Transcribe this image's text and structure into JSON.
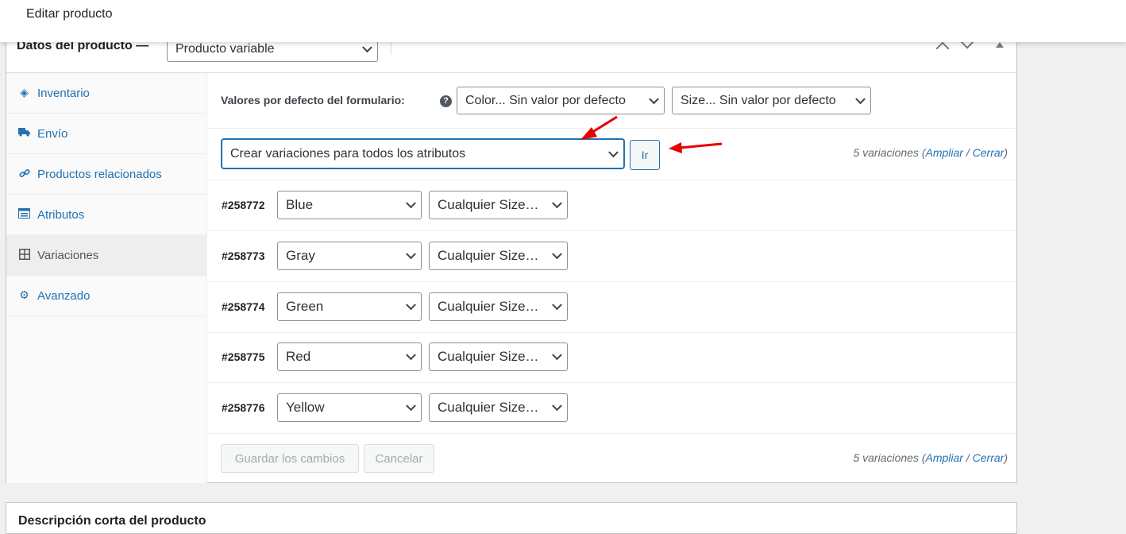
{
  "page": {
    "title": "Editar producto"
  },
  "product_data": {
    "header_label": "Datos del producto —",
    "product_type": "Producto variable"
  },
  "tabs": [
    {
      "label": "Inventario",
      "icon": "tag-icon"
    },
    {
      "label": "Envío",
      "icon": "truck-icon"
    },
    {
      "label": "Productos relacionados",
      "icon": "link-icon"
    },
    {
      "label": "Atributos",
      "icon": "list-icon"
    },
    {
      "label": "Variaciones",
      "icon": "grid-icon",
      "active": true
    },
    {
      "label": "Avanzado",
      "icon": "gear-icon"
    }
  ],
  "defaults": {
    "label": "Valores por defecto del formulario:",
    "help": "?",
    "color_select": "Color... Sin valor por defecto",
    "size_select": "Size... Sin valor por defecto"
  },
  "actions": {
    "bulk_select": "Crear variaciones para todos los atributos",
    "go_button": "Ir",
    "count": {
      "text": "5 variaciones (",
      "expand": "Ampliar",
      "sep": " / ",
      "close": "Cerrar",
      "end": ")"
    }
  },
  "variations": [
    {
      "id": "#258772",
      "color": "Blue",
      "size": "Cualquier Size…"
    },
    {
      "id": "#258773",
      "color": "Gray",
      "size": "Cualquier Size…"
    },
    {
      "id": "#258774",
      "color": "Green",
      "size": "Cualquier Size…"
    },
    {
      "id": "#258775",
      "color": "Red",
      "size": "Cualquier Size…"
    },
    {
      "id": "#258776",
      "color": "Yellow",
      "size": "Cualquier Size…"
    }
  ],
  "footer": {
    "save": "Guardar los cambios",
    "cancel": "Cancelar",
    "count": {
      "text": "5 variaciones (",
      "expand": "Ampliar",
      "sep": " / ",
      "close": "Cerrar",
      "end": ")"
    }
  },
  "next_box": {
    "title": "Descripción corta del producto"
  },
  "colors": {
    "link": "#2271b1",
    "annotation": "#e60000"
  }
}
